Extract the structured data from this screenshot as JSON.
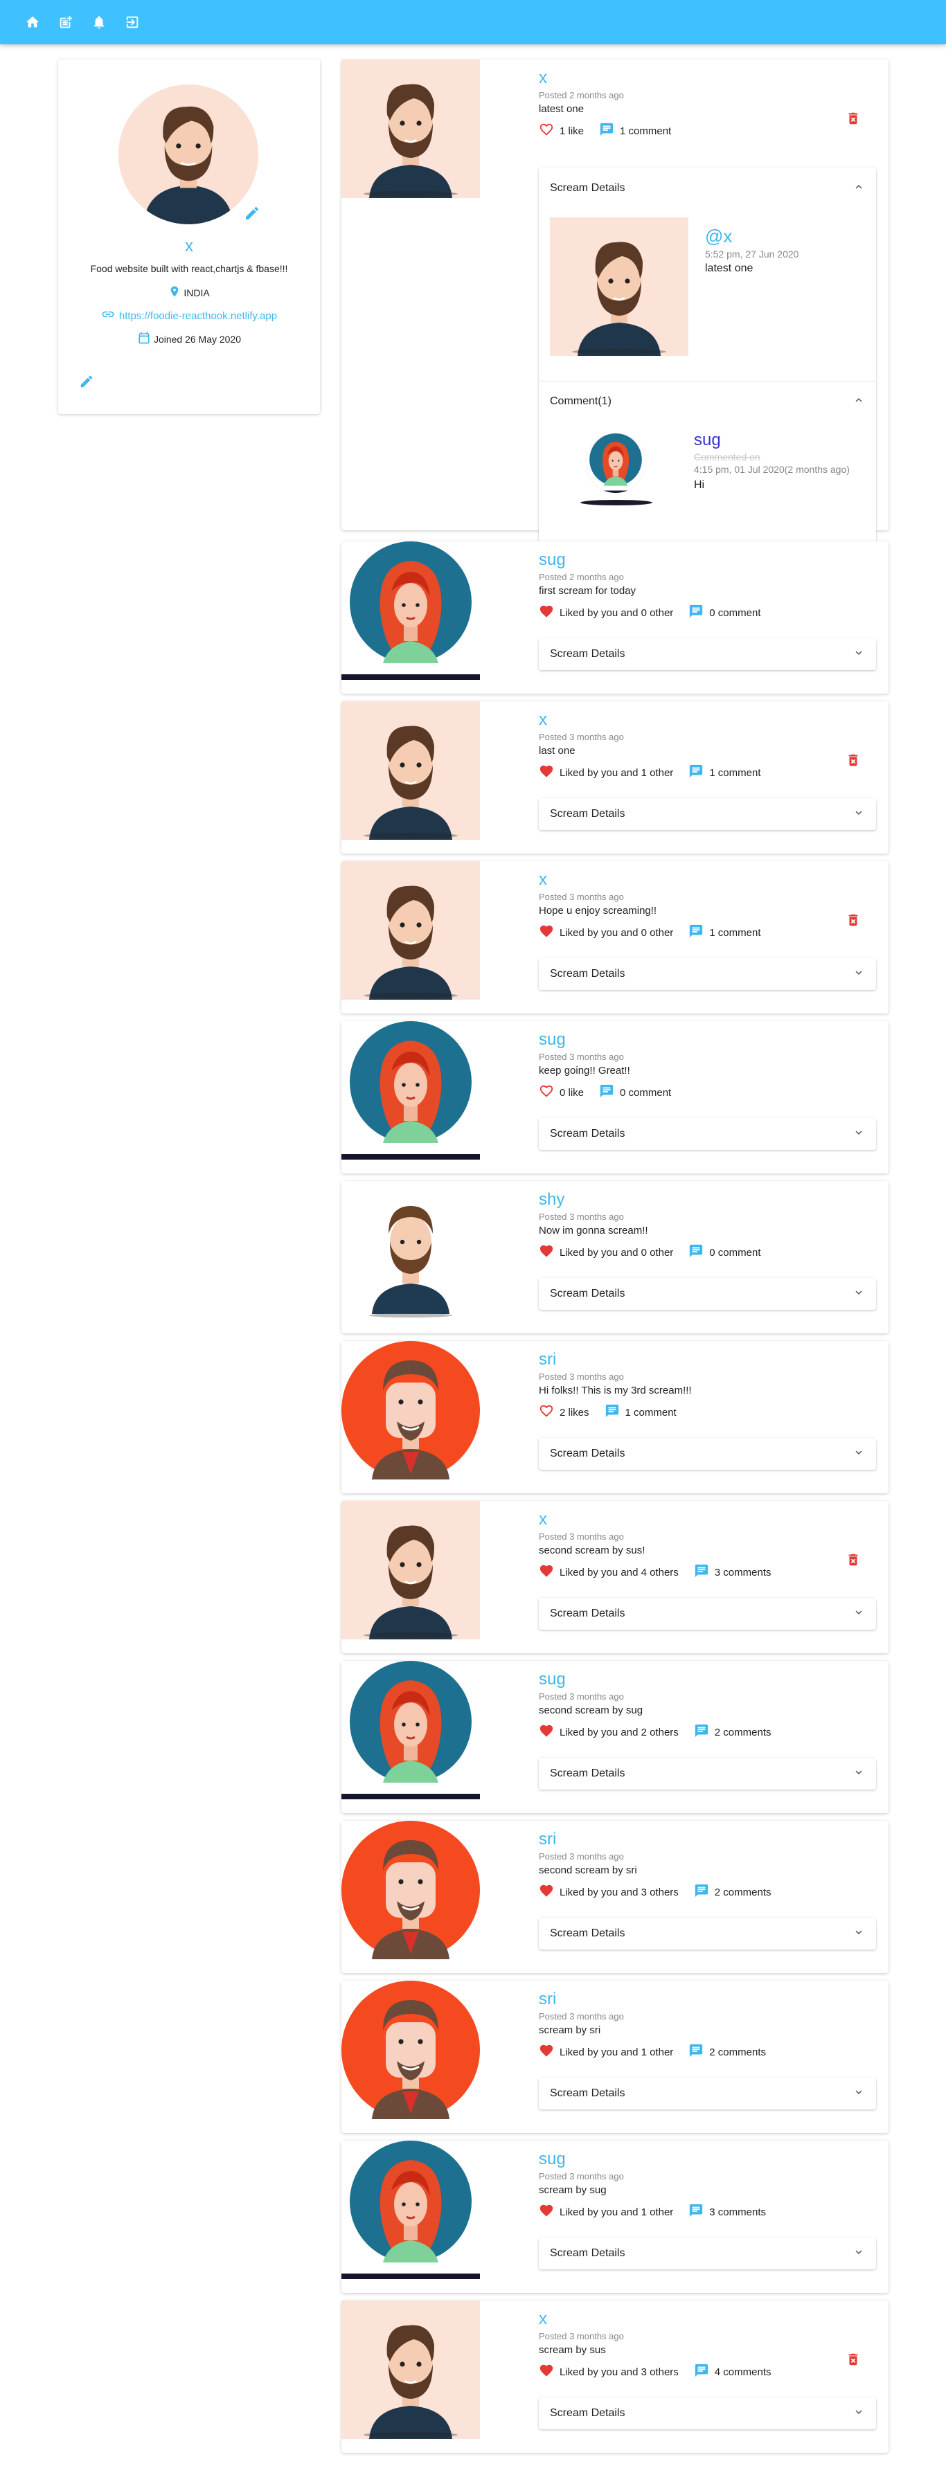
{
  "colors": {
    "accent": "#3fc1ff",
    "link": "#3fb6ec",
    "like_red": "#e53935",
    "comment_blue": "#3fb6ec",
    "comment_handle": "#3737c8",
    "delete_red": "#e53935"
  },
  "navbar": {
    "icons": [
      "home-icon",
      "post-add-icon",
      "notifications-icon",
      "logout-icon"
    ]
  },
  "profile": {
    "handle": "x",
    "bio": "Food website built with react,chartjs & fbase!!!",
    "location": "INDIA",
    "website": "https://foodie-reacthook.netlify.app",
    "joined": "Joined 26 May 2020"
  },
  "screams": [
    {
      "handle": "x",
      "date": "Posted 2 months ago",
      "body": "latest one",
      "liked": false,
      "likes": "1 like",
      "comments": "1 comment",
      "deletable": true,
      "avatar": "man",
      "details": {
        "title": "Scream Details",
        "handle": "@x",
        "date": "5:52 pm, 27 Jun 2020",
        "body": "latest one",
        "comments_title": "Comment(1)",
        "comment": {
          "handle": "sug",
          "fade": "Commented on",
          "date": "4:15 pm, 01 Jul 2020(2 months ago)",
          "body": "Hi"
        }
      }
    },
    {
      "handle": "sug",
      "date": "Posted 2 months ago",
      "body": "first scream for today",
      "liked": true,
      "likes": "Liked by you and 0 other",
      "comments": "0 comment",
      "deletable": false,
      "avatar": "woman"
    },
    {
      "handle": "x",
      "date": "Posted 3 months ago",
      "body": "last one",
      "liked": true,
      "likes": "Liked by you and 1 other",
      "comments": "1 comment",
      "deletable": true,
      "avatar": "man"
    },
    {
      "handle": "x",
      "date": "Posted 3 months ago",
      "body": "Hope u enjoy screaming!!",
      "liked": true,
      "likes": "Liked by you and 0 other",
      "comments": "1 comment",
      "deletable": true,
      "avatar": "man"
    },
    {
      "handle": "sug",
      "date": "Posted 3 months ago",
      "body": "keep going!! Great!!",
      "liked": false,
      "likes": "0 like",
      "comments": "0 comment",
      "deletable": false,
      "avatar": "woman"
    },
    {
      "handle": "shy",
      "date": "Posted 3 months ago",
      "body": "Now im gonna scream!!",
      "liked": true,
      "likes": "Liked by you and 0 other",
      "comments": "0 comment",
      "deletable": false,
      "avatar": "man2"
    },
    {
      "handle": "sri",
      "date": "Posted 3 months ago",
      "body": "Hi folks!! This is my 3rd scream!!!",
      "liked": false,
      "likes": "2 likes",
      "comments": "1 comment",
      "deletable": false,
      "avatar": "red"
    },
    {
      "handle": "x",
      "date": "Posted 3 months ago",
      "body": "second scream by sus!",
      "liked": true,
      "likes": "Liked by you and 4 others",
      "comments": "3 comments",
      "deletable": true,
      "avatar": "man"
    },
    {
      "handle": "sug",
      "date": "Posted 3 months ago",
      "body": "second scream by sug",
      "liked": true,
      "likes": "Liked by you and 2 others",
      "comments": "2 comments",
      "deletable": false,
      "avatar": "woman"
    },
    {
      "handle": "sri",
      "date": "Posted 3 months ago",
      "body": "second scream by sri",
      "liked": true,
      "likes": "Liked by you and 3 others",
      "comments": "2 comments",
      "deletable": false,
      "avatar": "red"
    },
    {
      "handle": "sri",
      "date": "Posted 3 months ago",
      "body": "scream by sri",
      "liked": true,
      "likes": "Liked by you and 1 other",
      "comments": "2 comments",
      "deletable": false,
      "avatar": "red"
    },
    {
      "handle": "sug",
      "date": "Posted 3 months ago",
      "body": "scream by sug",
      "liked": true,
      "likes": "Liked by you and 1 other",
      "comments": "3 comments",
      "deletable": false,
      "avatar": "woman"
    },
    {
      "handle": "x",
      "date": "Posted 3 months ago",
      "body": "scream by sus",
      "liked": true,
      "likes": "Liked by you and 3 others",
      "comments": "4 comments",
      "deletable": true,
      "avatar": "man"
    }
  ],
  "details_label": "Scream Details"
}
